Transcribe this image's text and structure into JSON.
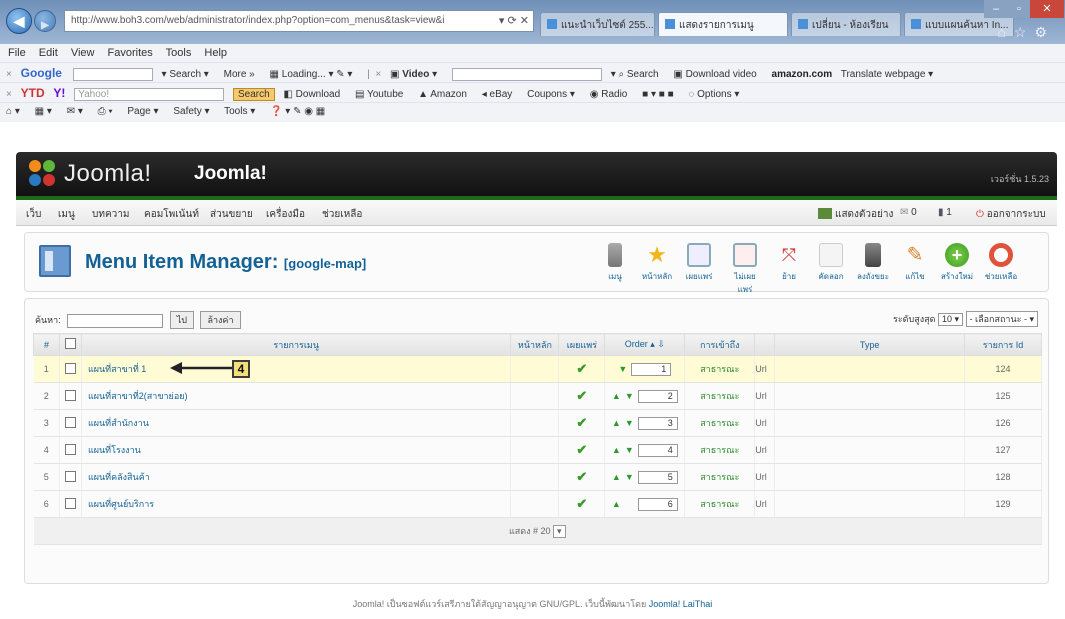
{
  "browser": {
    "url": "http://www.boh3.com/web/administrator/index.php?option=com_menus&task=view&i",
    "url_domain": "boh3.com",
    "tabs": [
      "แนะนำเว็บไซต์ 255...",
      "แสดงรายการเมนู",
      "เปลี่ยน - ห้องเรียน",
      "แบบแผนค้นหา In..."
    ],
    "menu": [
      "File",
      "Edit",
      "View",
      "Favorites",
      "Tools",
      "Help"
    ],
    "toolbar1": {
      "google": "Google",
      "search": "Search",
      "more": "More »",
      "loading": "Loading...",
      "video": "Video",
      "search2": "Search",
      "download_video": "Download video",
      "amazon": "amazon.com",
      "translate": "Translate webpage"
    },
    "toolbar2": {
      "ytd": "YTD",
      "yahoo": "Y!",
      "yahoo_field": "Yahoo!",
      "search_btn": "Search",
      "download": "Download",
      "youtube": "Youtube",
      "amazon": "Amazon",
      "ebay": "eBay",
      "coupons": "Coupons",
      "radio": "Radio",
      "options": "Options"
    },
    "toolbar3": {
      "page": "Page",
      "safety": "Safety",
      "tools": "Tools"
    }
  },
  "joomla": {
    "logo_text": "Joomla!",
    "site_name": "Joomla!",
    "version": "เวอร์ชั่น 1.5.23",
    "menu": [
      "เว็บ",
      "เมนู",
      "บทความ",
      "คอมโพเน้นท์",
      "ส่วนขยาย",
      "เครื่องมือ",
      "ช่วยเหลือ"
    ],
    "menu_right": {
      "preview": "แสดงตัวอย่าง",
      "messages": "0",
      "users": "1",
      "logout": "ออกจากระบบ"
    },
    "page_title": "Menu Item Manager:",
    "page_subtitle": "[google-map]",
    "tools": [
      "เมนู",
      "หน้าหลัก",
      "เผยแพร่",
      "ไม่เผยแพร่",
      "ย้าย",
      "คัดลอก",
      "ลงถังขยะ",
      "แก้ไข",
      "สร้างใหม่",
      "ช่วยเหลือ"
    ],
    "filter": {
      "label": "ค้นหา:",
      "go": "ไป",
      "reset": "ล้างค่า",
      "level_label": "ระดับสูงสุด",
      "level_value": "10",
      "state_value": "- เลือกสถานะ -"
    },
    "columns": [
      "#",
      "",
      "รายการเมนู",
      "หน้าหลัก",
      "เผยแพร่",
      "Order",
      "การเข้าถึง",
      "",
      "Type",
      "รายการ Id"
    ],
    "rows": [
      {
        "num": "1",
        "title": "แผนที่สาขาที่ 1",
        "order": "1",
        "access": "สาธารณะ",
        "type": "Url",
        "id": "124"
      },
      {
        "num": "2",
        "title": "แผนที่สาขาที่2(สาขาย่อย)",
        "order": "2",
        "access": "สาธารณะ",
        "type": "Url",
        "id": "125"
      },
      {
        "num": "3",
        "title": "แผนที่สำนักงาน",
        "order": "3",
        "access": "สาธารณะ",
        "type": "Url",
        "id": "126"
      },
      {
        "num": "4",
        "title": "แผนที่โรงงาน",
        "order": "4",
        "access": "สาธารณะ",
        "type": "Url",
        "id": "127"
      },
      {
        "num": "5",
        "title": "แผนที่คลังสินค้า",
        "order": "5",
        "access": "สาธารณะ",
        "type": "Url",
        "id": "128"
      },
      {
        "num": "6",
        "title": "แผนที่ศูนย์บริการ",
        "order": "6",
        "access": "สาธารณะ",
        "type": "Url",
        "id": "129"
      }
    ],
    "pagination": "แสดง # 20",
    "callout_number": "4",
    "footer_text": "Joomla! เป็นซอฟต์แวร์เสรีภายใต้สัญญาอนุญาต GNU/GPL. เว็บนี้พัฒนาโดย",
    "footer_link": "Joomla! LaiThai"
  },
  "colors": {
    "accent": "#146295",
    "header_dark": "#1a1a1a",
    "highlight_row": "#fffbd4",
    "publish_green": "#3a9a2a"
  }
}
